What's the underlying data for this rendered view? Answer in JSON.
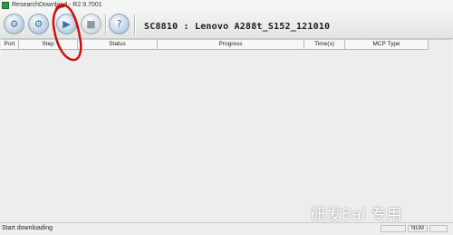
{
  "window": {
    "title": "ResearchDownload - R2.9.7001"
  },
  "toolbar": {
    "buttons": [
      {
        "name": "load-packet",
        "icon": "gear-icon"
      },
      {
        "name": "settings",
        "icon": "gears-icon"
      },
      {
        "name": "start-downloading",
        "icon": "play-icon"
      },
      {
        "name": "stop-downloading",
        "icon": "stop-icon"
      },
      {
        "name": "help",
        "icon": "question-icon"
      }
    ],
    "device_info": "SC8810 : Lenovo A288t_S152_121010"
  },
  "grid": {
    "columns": [
      "Port",
      "Step",
      "Status",
      "Progress",
      "Time(s)",
      "MCP Type"
    ],
    "rows": []
  },
  "statusbar": {
    "message": "Start downloading",
    "indicator": "NUM"
  },
  "watermark": "研发Bai 专用",
  "colors": {
    "annotation": "#cc1111",
    "accent": "#3b6fa3"
  }
}
